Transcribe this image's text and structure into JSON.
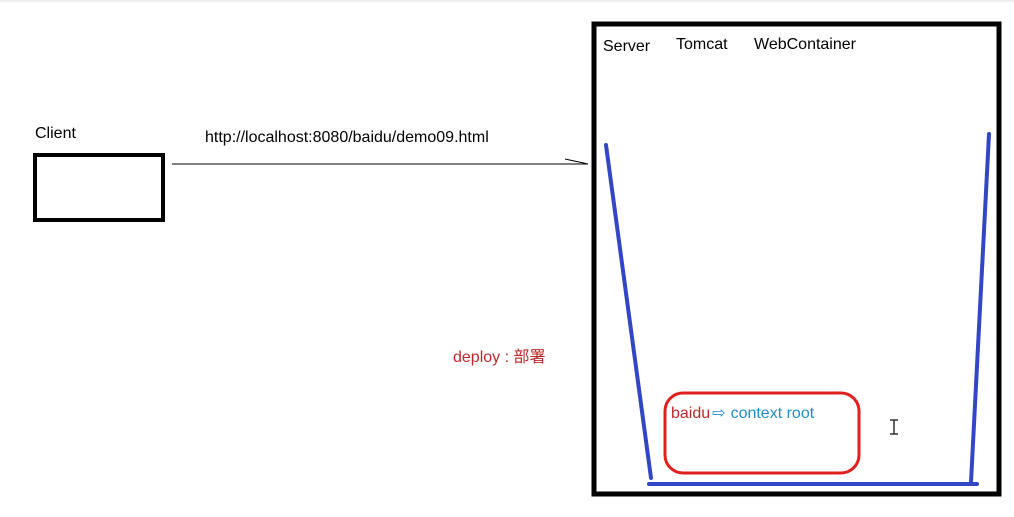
{
  "client": {
    "label": "Client"
  },
  "request": {
    "url": "http://localhost:8080/baidu/demo09.html"
  },
  "server": {
    "labels": [
      "Server",
      "Tomcat",
      "WebContainer"
    ]
  },
  "deploy": {
    "label": "deploy : 部署",
    "color": "#c0282a"
  },
  "context": {
    "app_name": "baidu",
    "arrow": "⇨",
    "label": "context root",
    "app_color": "#c0282a",
    "label_color": "#1f8fce",
    "box_color": "#e0201e"
  },
  "container": {
    "color": "#3346c6"
  }
}
